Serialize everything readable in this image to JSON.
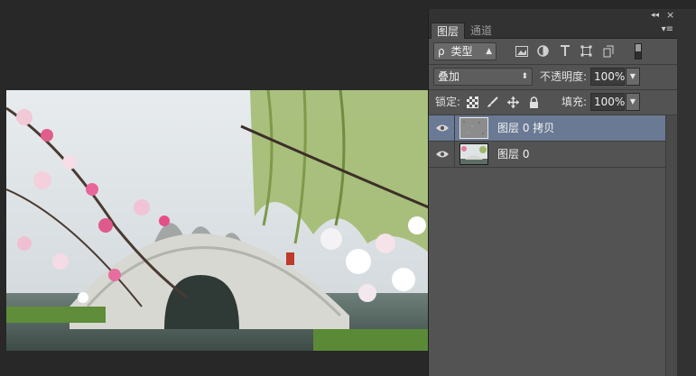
{
  "panel": {
    "collapse_icon": "◂◂",
    "close_icon": "×",
    "menu_icon": "▾≡",
    "tabs": [
      {
        "label": "图层"
      },
      {
        "label": "通道"
      }
    ],
    "filter": {
      "label": "类型",
      "search_glyph": "ρ"
    },
    "blend_mode": "叠加",
    "opacity_label": "不透明度:",
    "opacity_value": "100%",
    "lock_label": "锁定:",
    "fill_label": "填充:",
    "fill_value": "100%",
    "layers": [
      {
        "name": "图层 0 拷贝",
        "selected": true
      },
      {
        "name": "图层 0",
        "selected": false
      }
    ]
  },
  "colors": {
    "panel_bg": "#535353",
    "selected_layer": "#6a7a94",
    "workspace": "#282828"
  }
}
